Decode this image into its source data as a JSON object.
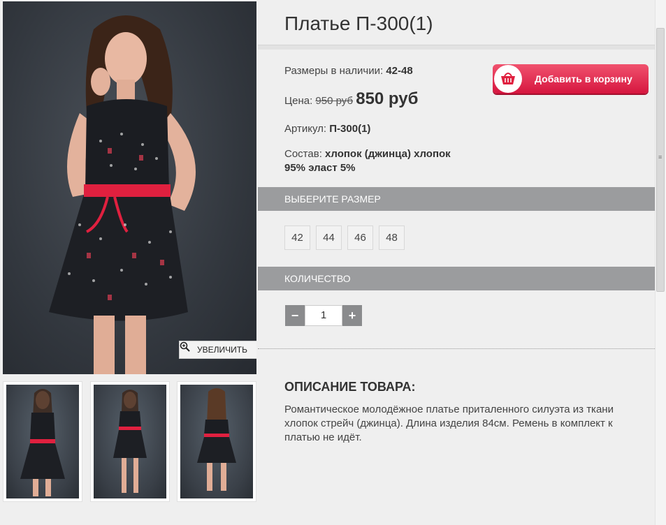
{
  "product": {
    "title": "Платье П-300(1)",
    "sizes_label": "Размеры в наличии:",
    "sizes_value": "42-48",
    "price_label": "Цена:",
    "old_price": "950 руб",
    "new_price": "850 руб",
    "article_label": "Артикул:",
    "article_value": "П-300(1)",
    "composition_label": "Состав:",
    "composition_value_1": "хлопок (джинца) хлопок",
    "composition_value_2": "95% эласт 5%"
  },
  "cart_button": {
    "label": "Добавить в корзину",
    "icon": "basket-icon"
  },
  "gallery": {
    "zoom_label": "УВЕЛИЧИТЬ",
    "zoom_icon": "zoom-in-icon",
    "thumbnail_count": 3
  },
  "size_section": {
    "title": "ВЫБЕРИТЕ РАЗМЕР",
    "options": [
      "42",
      "44",
      "46",
      "48"
    ]
  },
  "quantity_section": {
    "title": "КОЛИЧЕСТВО",
    "minus": "−",
    "value": "1",
    "plus": "+"
  },
  "description": {
    "title": "ОПИСАНИЕ ТОВАРА:",
    "text": "Романтическое молодёжное платье приталенного силуэта из ткани хлопок стрейч (джинца). Длина изделия 84см. Ремень в комплект к платью не идёт."
  },
  "colors": {
    "accent_red": "#e0203f",
    "section_gray": "#9b9c9e",
    "background": "#efefef"
  }
}
